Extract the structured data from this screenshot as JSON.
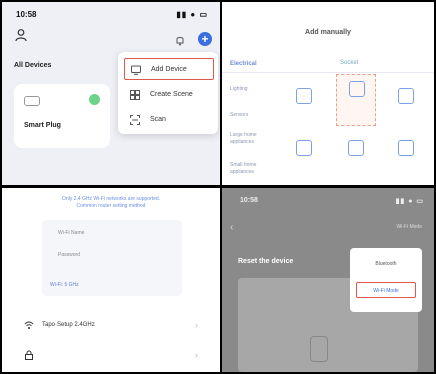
{
  "q1": {
    "status_time": "10:58",
    "status_icons": "▮▮ ● ▭",
    "section_title": "All Devices",
    "device_card": {
      "name": "Smart Plug"
    },
    "menu": {
      "items": [
        {
          "label": "Add Device"
        },
        {
          "label": "Create Scene"
        },
        {
          "label": "Scan"
        }
      ]
    }
  },
  "q2": {
    "title": "Add manually",
    "left_tab": "Electrical",
    "top_tab": "Socket",
    "categories": [
      "Lighting",
      "Sensors",
      "Large home appliances",
      "Small home appliances"
    ]
  },
  "q3": {
    "tip": "Only 2.4 GHz Wi-Fi networks are supported.\nCommon router setting method",
    "fields": [
      "Wi-Fi Name",
      "Password"
    ],
    "wifi_hint": "Wi-Fi: 5 GHz",
    "rows": [
      {
        "label": "Tapo·Setup 2.4GHz"
      },
      {
        "label": ""
      }
    ]
  },
  "q4": {
    "status_time": "10:58",
    "status_icons": "▮▮ ● ▭",
    "crumb": "Wi-Fi Mode",
    "title": "Reset the device",
    "popup": {
      "options": [
        "Bluetooth",
        "Wi-Fi Mode"
      ]
    }
  },
  "colors": {
    "accent_blue": "#3b6fe0",
    "highlight_red": "#e0564a",
    "online_green": "#6bd48a"
  }
}
